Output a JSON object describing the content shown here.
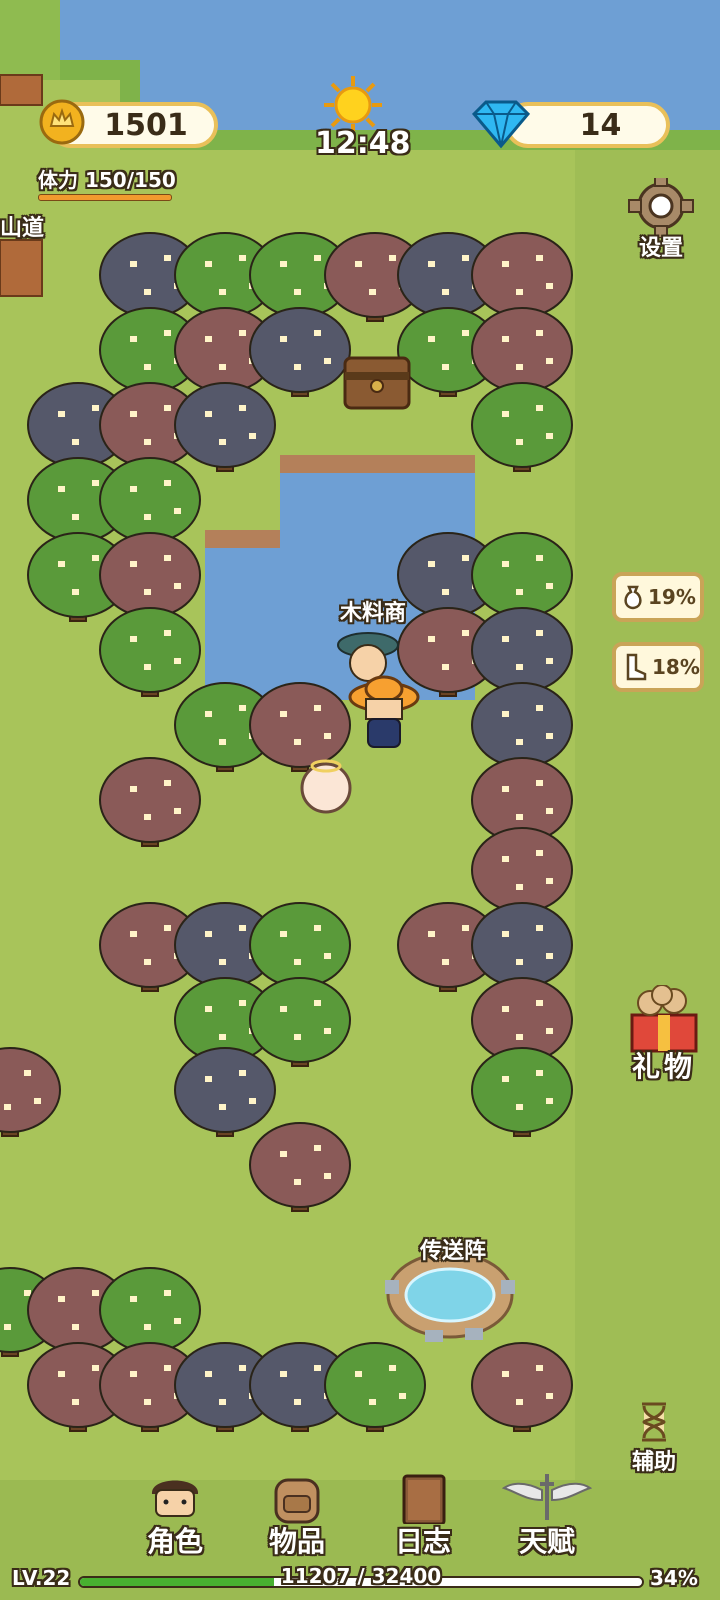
{
  "hud": {
    "coins": "1501",
    "gems": "14",
    "clock": "12:48",
    "stamina_label": "体力",
    "stamina_value": "150/150",
    "road_label": "山道",
    "settings_label": "设置"
  },
  "buffs": [
    {
      "icon": "money-bag-icon",
      "value": "19%"
    },
    {
      "icon": "boot-icon",
      "value": "18%"
    }
  ],
  "side": {
    "gift_label": "礼物",
    "assist_label": "辅助"
  },
  "world": {
    "npc_name": "木料商",
    "portal_name": "传送阵"
  },
  "nav": {
    "role": "角色",
    "items": "物品",
    "log": "日志",
    "talent": "天赋"
  },
  "progress": {
    "level": "LV.22",
    "xp_text": "11207 / 32400",
    "xp_current": 11207,
    "xp_max": 32400,
    "percent": "34%"
  },
  "colors": {
    "grass": "#a8c45a",
    "water": "#6e9fd4",
    "tree_green": "#5a9a3a",
    "tree_red": "#8a5a58",
    "tree_dark": "#55586a",
    "gold_border": "#e9c05a"
  }
}
